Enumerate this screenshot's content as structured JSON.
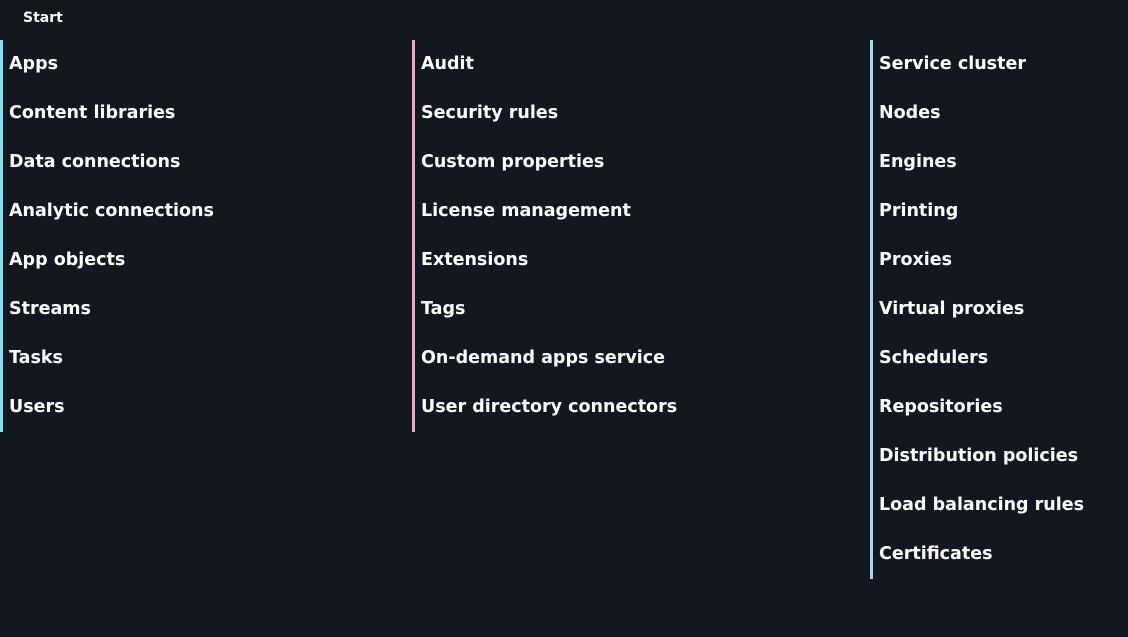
{
  "header": {
    "title": "Start"
  },
  "columns": [
    {
      "accent": "#7fe0ee",
      "items": [
        "Apps",
        "Content libraries",
        "Data connections",
        "Analytic connections",
        "App objects",
        "Streams",
        "Tasks",
        "Users"
      ]
    },
    {
      "accent": "#f4a6c8",
      "items": [
        "Audit",
        "Security rules",
        "Custom properties",
        "License management",
        "Extensions",
        "Tags",
        "On-demand apps service",
        "User directory connectors"
      ]
    },
    {
      "accent": "#9fd9f2",
      "items": [
        "Service cluster",
        "Nodes",
        "Engines",
        "Printing",
        "Proxies",
        "Virtual proxies",
        "Schedulers",
        "Repositories",
        "Distribution policies",
        "Load balancing rules",
        "Certificates"
      ]
    }
  ]
}
